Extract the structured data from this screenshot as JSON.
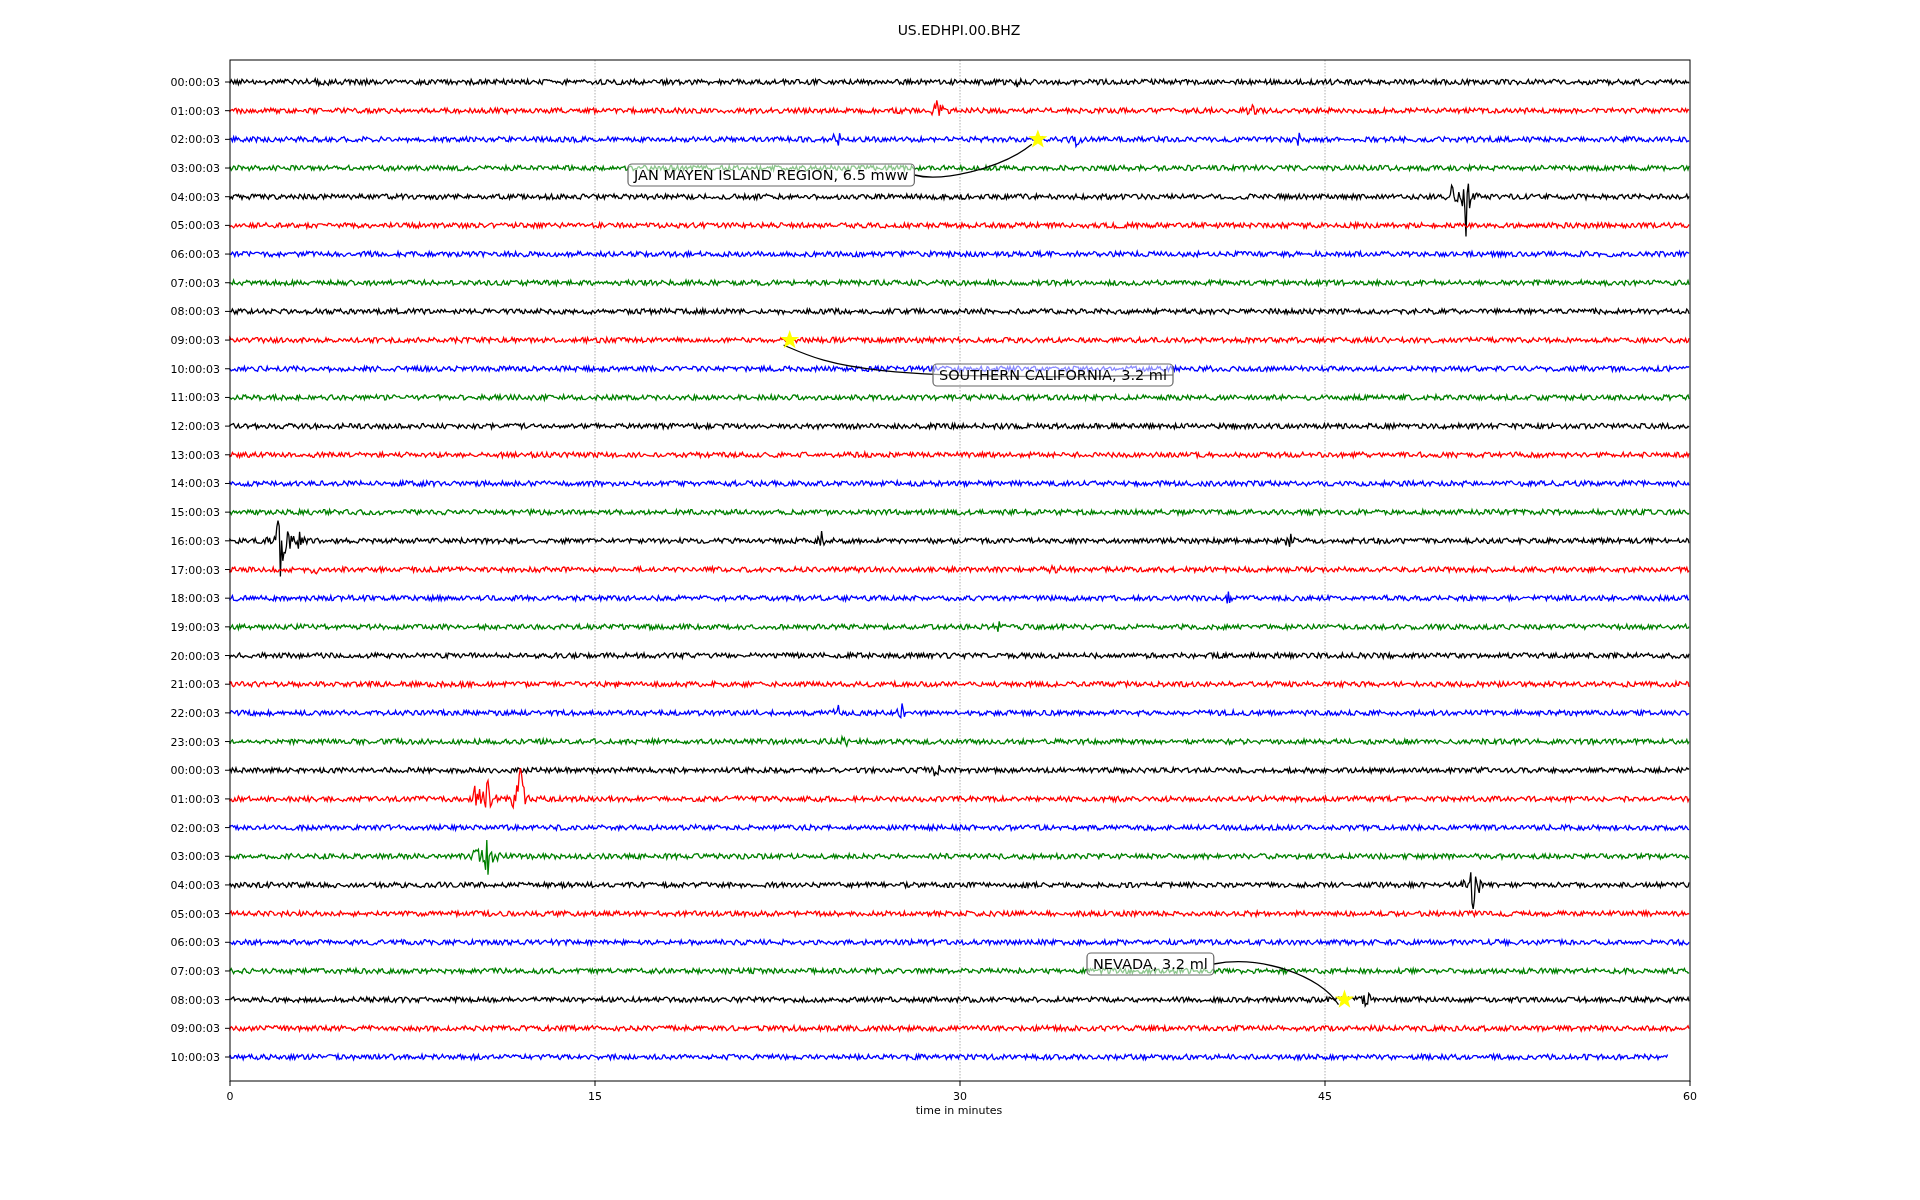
{
  "plot": {
    "title": "US.EDHPI.00.BHZ",
    "xlabel": "time in minutes",
    "xticks": [
      "0",
      "15",
      "30",
      "45",
      "60"
    ],
    "traces": [
      {
        "label": "00:00:03",
        "color": "#000000"
      },
      {
        "label": "01:00:03",
        "color": "#ff0000"
      },
      {
        "label": "02:00:03",
        "color": "#0000ff",
        "event": {
          "label": "JAN MAYEN ISLAND REGION, 6.5 mww"
        }
      },
      {
        "label": "03:00:03",
        "color": "#008000"
      },
      {
        "label": "04:00:03",
        "color": "#000000"
      },
      {
        "label": "05:00:03",
        "color": "#ff0000"
      },
      {
        "label": "06:00:03",
        "color": "#0000ff"
      },
      {
        "label": "07:00:03",
        "color": "#008000"
      },
      {
        "label": "08:00:03",
        "color": "#000000"
      },
      {
        "label": "09:00:03",
        "color": "#ff0000",
        "event": {
          "label": "SOUTHERN CALIFORNIA, 3.2 ml"
        }
      },
      {
        "label": "10:00:03",
        "color": "#0000ff"
      },
      {
        "label": "11:00:03",
        "color": "#008000"
      },
      {
        "label": "12:00:03",
        "color": "#000000"
      },
      {
        "label": "13:00:03",
        "color": "#ff0000"
      },
      {
        "label": "14:00:03",
        "color": "#0000ff"
      },
      {
        "label": "15:00:03",
        "color": "#008000"
      },
      {
        "label": "16:00:03",
        "color": "#000000"
      },
      {
        "label": "17:00:03",
        "color": "#ff0000"
      },
      {
        "label": "18:00:03",
        "color": "#0000ff"
      },
      {
        "label": "19:00:03",
        "color": "#008000"
      },
      {
        "label": "20:00:03",
        "color": "#000000"
      },
      {
        "label": "21:00:03",
        "color": "#ff0000"
      },
      {
        "label": "22:00:03",
        "color": "#0000ff"
      },
      {
        "label": "23:00:03",
        "color": "#008000"
      },
      {
        "label": "00:00:03",
        "color": "#000000"
      },
      {
        "label": "01:00:03",
        "color": "#ff0000"
      },
      {
        "label": "02:00:03",
        "color": "#0000ff"
      },
      {
        "label": "03:00:03",
        "color": "#008000"
      },
      {
        "label": "04:00:03",
        "color": "#000000"
      },
      {
        "label": "05:00:03",
        "color": "#ff0000"
      },
      {
        "label": "06:00:03",
        "color": "#0000ff"
      },
      {
        "label": "07:00:03",
        "color": "#008000"
      },
      {
        "label": "08:00:03",
        "color": "#000000",
        "event": {
          "label": "NEVADA, 3.2 ml"
        }
      },
      {
        "label": "09:00:03",
        "color": "#ff0000"
      },
      {
        "label": "10:00:03",
        "color": "#0000ff"
      }
    ]
  }
}
